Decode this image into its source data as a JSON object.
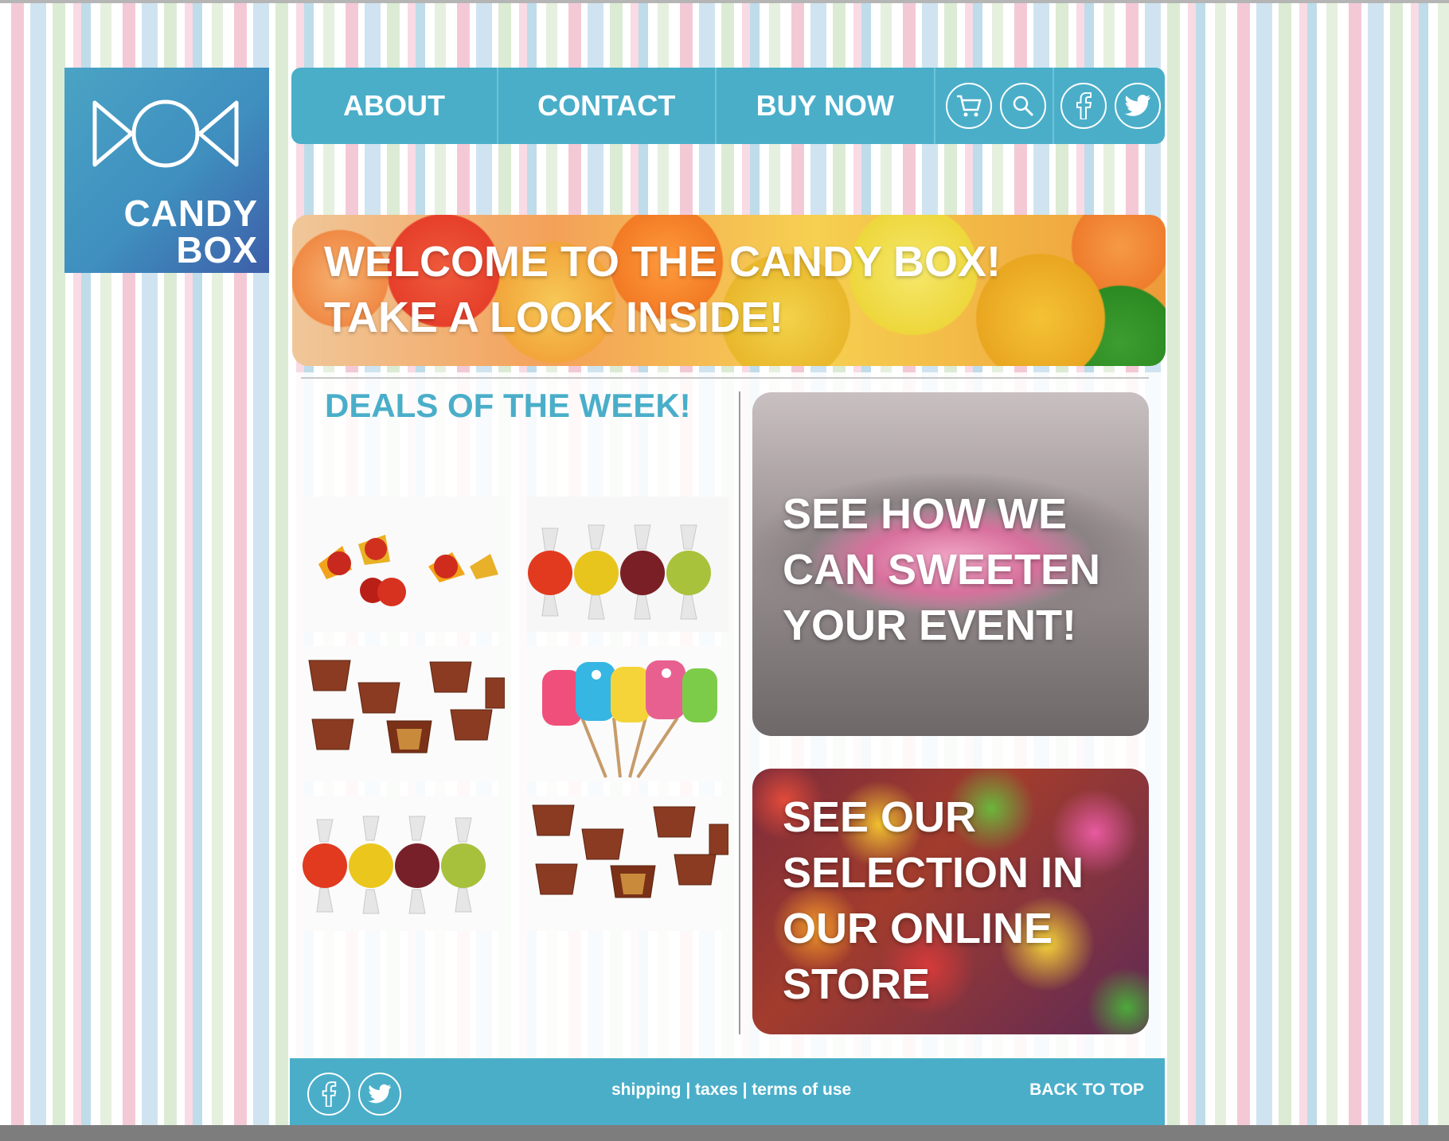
{
  "brand": {
    "line1": "CANDY",
    "line2": "BOX",
    "icon": "candy-wrapper-icon"
  },
  "nav": {
    "items": [
      {
        "label": "ABOUT"
      },
      {
        "label": "CONTACT"
      },
      {
        "label": "BUY NOW"
      }
    ],
    "icons": [
      "cart-icon",
      "search-icon",
      "facebook-icon",
      "twitter-icon"
    ]
  },
  "hero": {
    "line1": "WELCOME TO THE CANDY BOX!",
    "line2": "TAKE A LOOK INSIDE!"
  },
  "deals": {
    "title": "DEALS OF THE WEEK!",
    "products": [
      {
        "image": "wrapped red candies"
      },
      {
        "image": "wrapped fruit hard candies"
      },
      {
        "image": "chocolate caramel cups"
      },
      {
        "image": "character lollipops"
      },
      {
        "image": "wrapped fruit hard candies"
      },
      {
        "image": "chocolate caramel cups"
      }
    ]
  },
  "promos": {
    "event": {
      "line1": "SEE HOW WE",
      "line2": "CAN SWEETEN",
      "line3": "YOUR EVENT!"
    },
    "store": {
      "line1": "SEE OUR",
      "line2": "SELECTION IN",
      "line3": "OUR ONLINE",
      "line4": "STORE"
    }
  },
  "footer": {
    "links": [
      "shipping",
      "taxes",
      "terms of use"
    ],
    "separator": " | ",
    "back_to_top": "BACK TO TOP",
    "icons": [
      "facebook-icon",
      "twitter-icon"
    ]
  },
  "colors": {
    "accent": "#4aaec9",
    "logo_start": "#4aa3c4",
    "logo_end": "#3d5ea8"
  }
}
